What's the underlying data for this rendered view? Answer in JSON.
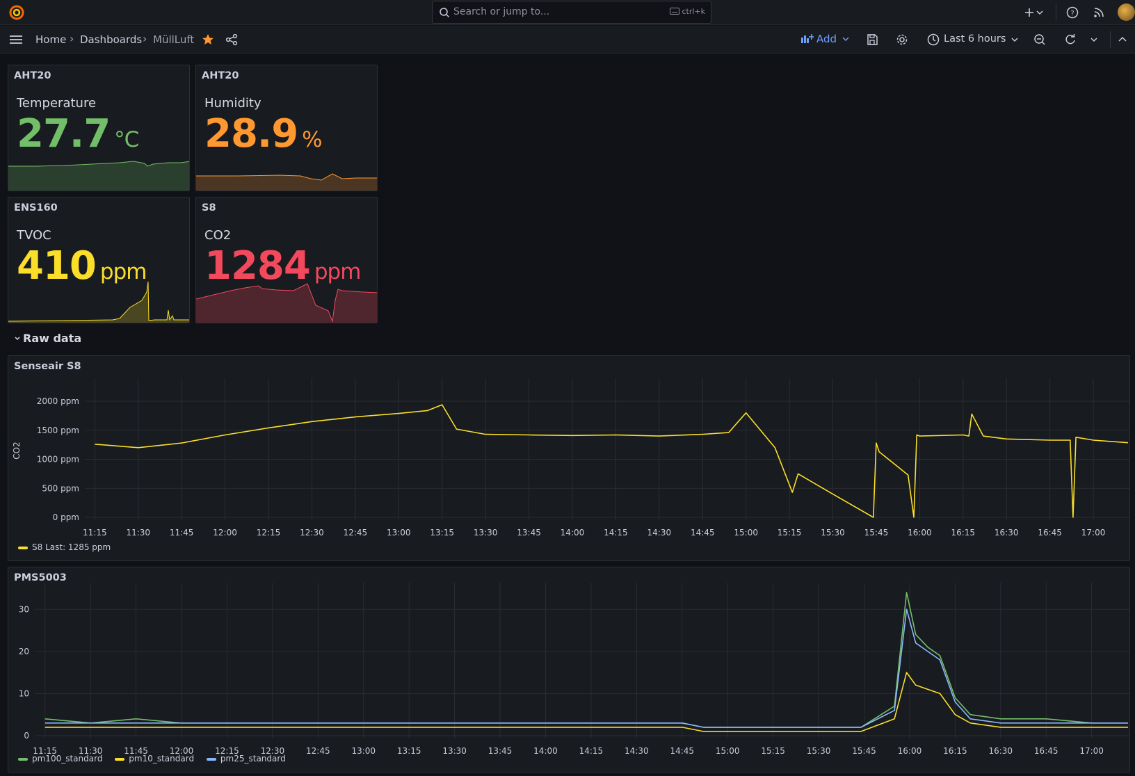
{
  "topbar": {
    "search_placeholder": "Search or jump to...",
    "shortcut": "ctrl+k"
  },
  "breadcrumb": {
    "home": "Home",
    "dashboards": "Dashboards",
    "current": "MüllLuft"
  },
  "toolbar": {
    "add_label": "Add",
    "time_range": "Last 6 hours"
  },
  "stats": [
    {
      "sensor": "AHT20",
      "label": "Temperature",
      "value": "27.7",
      "unit": "°C",
      "color": "#73bf69"
    },
    {
      "sensor": "AHT20",
      "label": "Humidity",
      "value": "28.9",
      "unit": "%",
      "color": "#ff9830"
    },
    {
      "sensor": "ENS160",
      "label": "TVOC",
      "value": "410",
      "unit": "ppm",
      "color": "#fade2a"
    },
    {
      "sensor": "S8",
      "label": "CO2",
      "value": "1284",
      "unit": "ppm",
      "color": "#f2495c"
    }
  ],
  "row": {
    "title": "Raw data"
  },
  "chart_data": [
    {
      "title": "Senseair S8",
      "type": "line",
      "ylabel": "CO2",
      "ylim": [
        0,
        2300
      ],
      "y_ticks": [
        "0 ppm",
        "500 ppm",
        "1000 ppm",
        "1500 ppm",
        "2000 ppm"
      ],
      "x_ticks": [
        "11:15",
        "11:30",
        "11:45",
        "12:00",
        "12:15",
        "12:30",
        "12:45",
        "13:00",
        "13:15",
        "13:30",
        "13:45",
        "14:00",
        "14:15",
        "14:30",
        "14:45",
        "15:00",
        "15:15",
        "15:30",
        "15:45",
        "16:00",
        "16:15",
        "16:30",
        "16:45",
        "17:00"
      ],
      "series": [
        {
          "name": "S8",
          "legend": "S8  Last: 1285 ppm",
          "color": "#fade2a",
          "x": [
            "11:15",
            "11:30",
            "11:45",
            "12:00",
            "12:15",
            "12:30",
            "12:45",
            "13:00",
            "13:10",
            "13:15",
            "13:20",
            "13:30",
            "13:45",
            "14:00",
            "14:15",
            "14:30",
            "14:45",
            "14:54",
            "15:00",
            "15:10",
            "15:16",
            "15:18",
            "15:30",
            "15:44",
            "15:45",
            "15:46",
            "15:56",
            "15:58",
            "15:59",
            "16:00",
            "16:15",
            "16:17",
            "16:18",
            "16:22",
            "16:30",
            "16:45",
            "16:52",
            "16:53",
            "16:54",
            "17:00",
            "17:12"
          ],
          "values": [
            1260,
            1200,
            1280,
            1420,
            1540,
            1650,
            1730,
            1790,
            1840,
            1940,
            1520,
            1430,
            1420,
            1410,
            1420,
            1400,
            1430,
            1460,
            1800,
            1200,
            430,
            750,
            400,
            0,
            1280,
            1130,
            730,
            0,
            1420,
            1400,
            1420,
            1400,
            1780,
            1400,
            1350,
            1330,
            1330,
            0,
            1380,
            1330,
            1285
          ]
        }
      ]
    },
    {
      "title": "PMS5003",
      "type": "line",
      "ylim": [
        0,
        35
      ],
      "y_ticks": [
        "0",
        "10",
        "20",
        "30"
      ],
      "x_ticks": [
        "11:15",
        "11:30",
        "11:45",
        "12:00",
        "12:15",
        "12:30",
        "12:45",
        "13:00",
        "13:15",
        "13:30",
        "13:45",
        "14:00",
        "14:15",
        "14:30",
        "14:45",
        "15:00",
        "15:15",
        "15:30",
        "15:45",
        "16:00",
        "16:15",
        "16:30",
        "16:45",
        "17:00"
      ],
      "series": [
        {
          "name": "pm100_standard",
          "color": "#73bf69",
          "x": [
            "11:15",
            "11:30",
            "11:45",
            "12:00",
            "12:15",
            "12:30",
            "12:45",
            "13:00",
            "13:15",
            "13:30",
            "13:45",
            "14:00",
            "14:15",
            "14:30",
            "14:45",
            "14:52",
            "15:44",
            "15:55",
            "15:59",
            "16:02",
            "16:06",
            "16:10",
            "16:15",
            "16:20",
            "16:30",
            "16:45",
            "17:00",
            "17:12"
          ],
          "values": [
            4,
            3,
            4,
            3,
            3,
            3,
            3,
            3,
            3,
            3,
            3,
            3,
            3,
            3,
            3,
            2,
            2,
            7,
            34,
            24,
            21,
            19,
            9,
            5,
            4,
            4,
            3,
            3
          ]
        },
        {
          "name": "pm10_standard",
          "color": "#fade2a",
          "x": [
            "11:15",
            "11:30",
            "11:45",
            "12:00",
            "12:15",
            "12:30",
            "12:45",
            "13:00",
            "13:15",
            "13:30",
            "13:45",
            "14:00",
            "14:15",
            "14:30",
            "14:45",
            "14:52",
            "15:44",
            "15:55",
            "15:59",
            "16:02",
            "16:06",
            "16:10",
            "16:15",
            "16:20",
            "16:30",
            "16:45",
            "17:00",
            "17:12"
          ],
          "values": [
            2,
            2,
            2,
            2,
            2,
            2,
            2,
            2,
            2,
            2,
            2,
            2,
            2,
            2,
            2,
            1,
            1,
            4,
            15,
            12,
            11,
            10,
            5,
            3,
            2,
            2,
            2,
            2
          ]
        },
        {
          "name": "pm25_standard",
          "color": "#8ab8ff",
          "x": [
            "11:15",
            "11:30",
            "11:45",
            "12:00",
            "12:15",
            "12:30",
            "12:45",
            "13:00",
            "13:15",
            "13:30",
            "13:45",
            "14:00",
            "14:15",
            "14:30",
            "14:45",
            "14:52",
            "15:44",
            "15:55",
            "15:59",
            "16:02",
            "16:06",
            "16:10",
            "16:15",
            "16:20",
            "16:30",
            "16:45",
            "17:00",
            "17:12"
          ],
          "values": [
            3,
            3,
            3,
            3,
            3,
            3,
            3,
            3,
            3,
            3,
            3,
            3,
            3,
            3,
            3,
            2,
            2,
            6,
            30,
            22,
            20,
            18,
            8,
            4,
            3,
            3,
            3,
            3
          ]
        }
      ]
    }
  ]
}
